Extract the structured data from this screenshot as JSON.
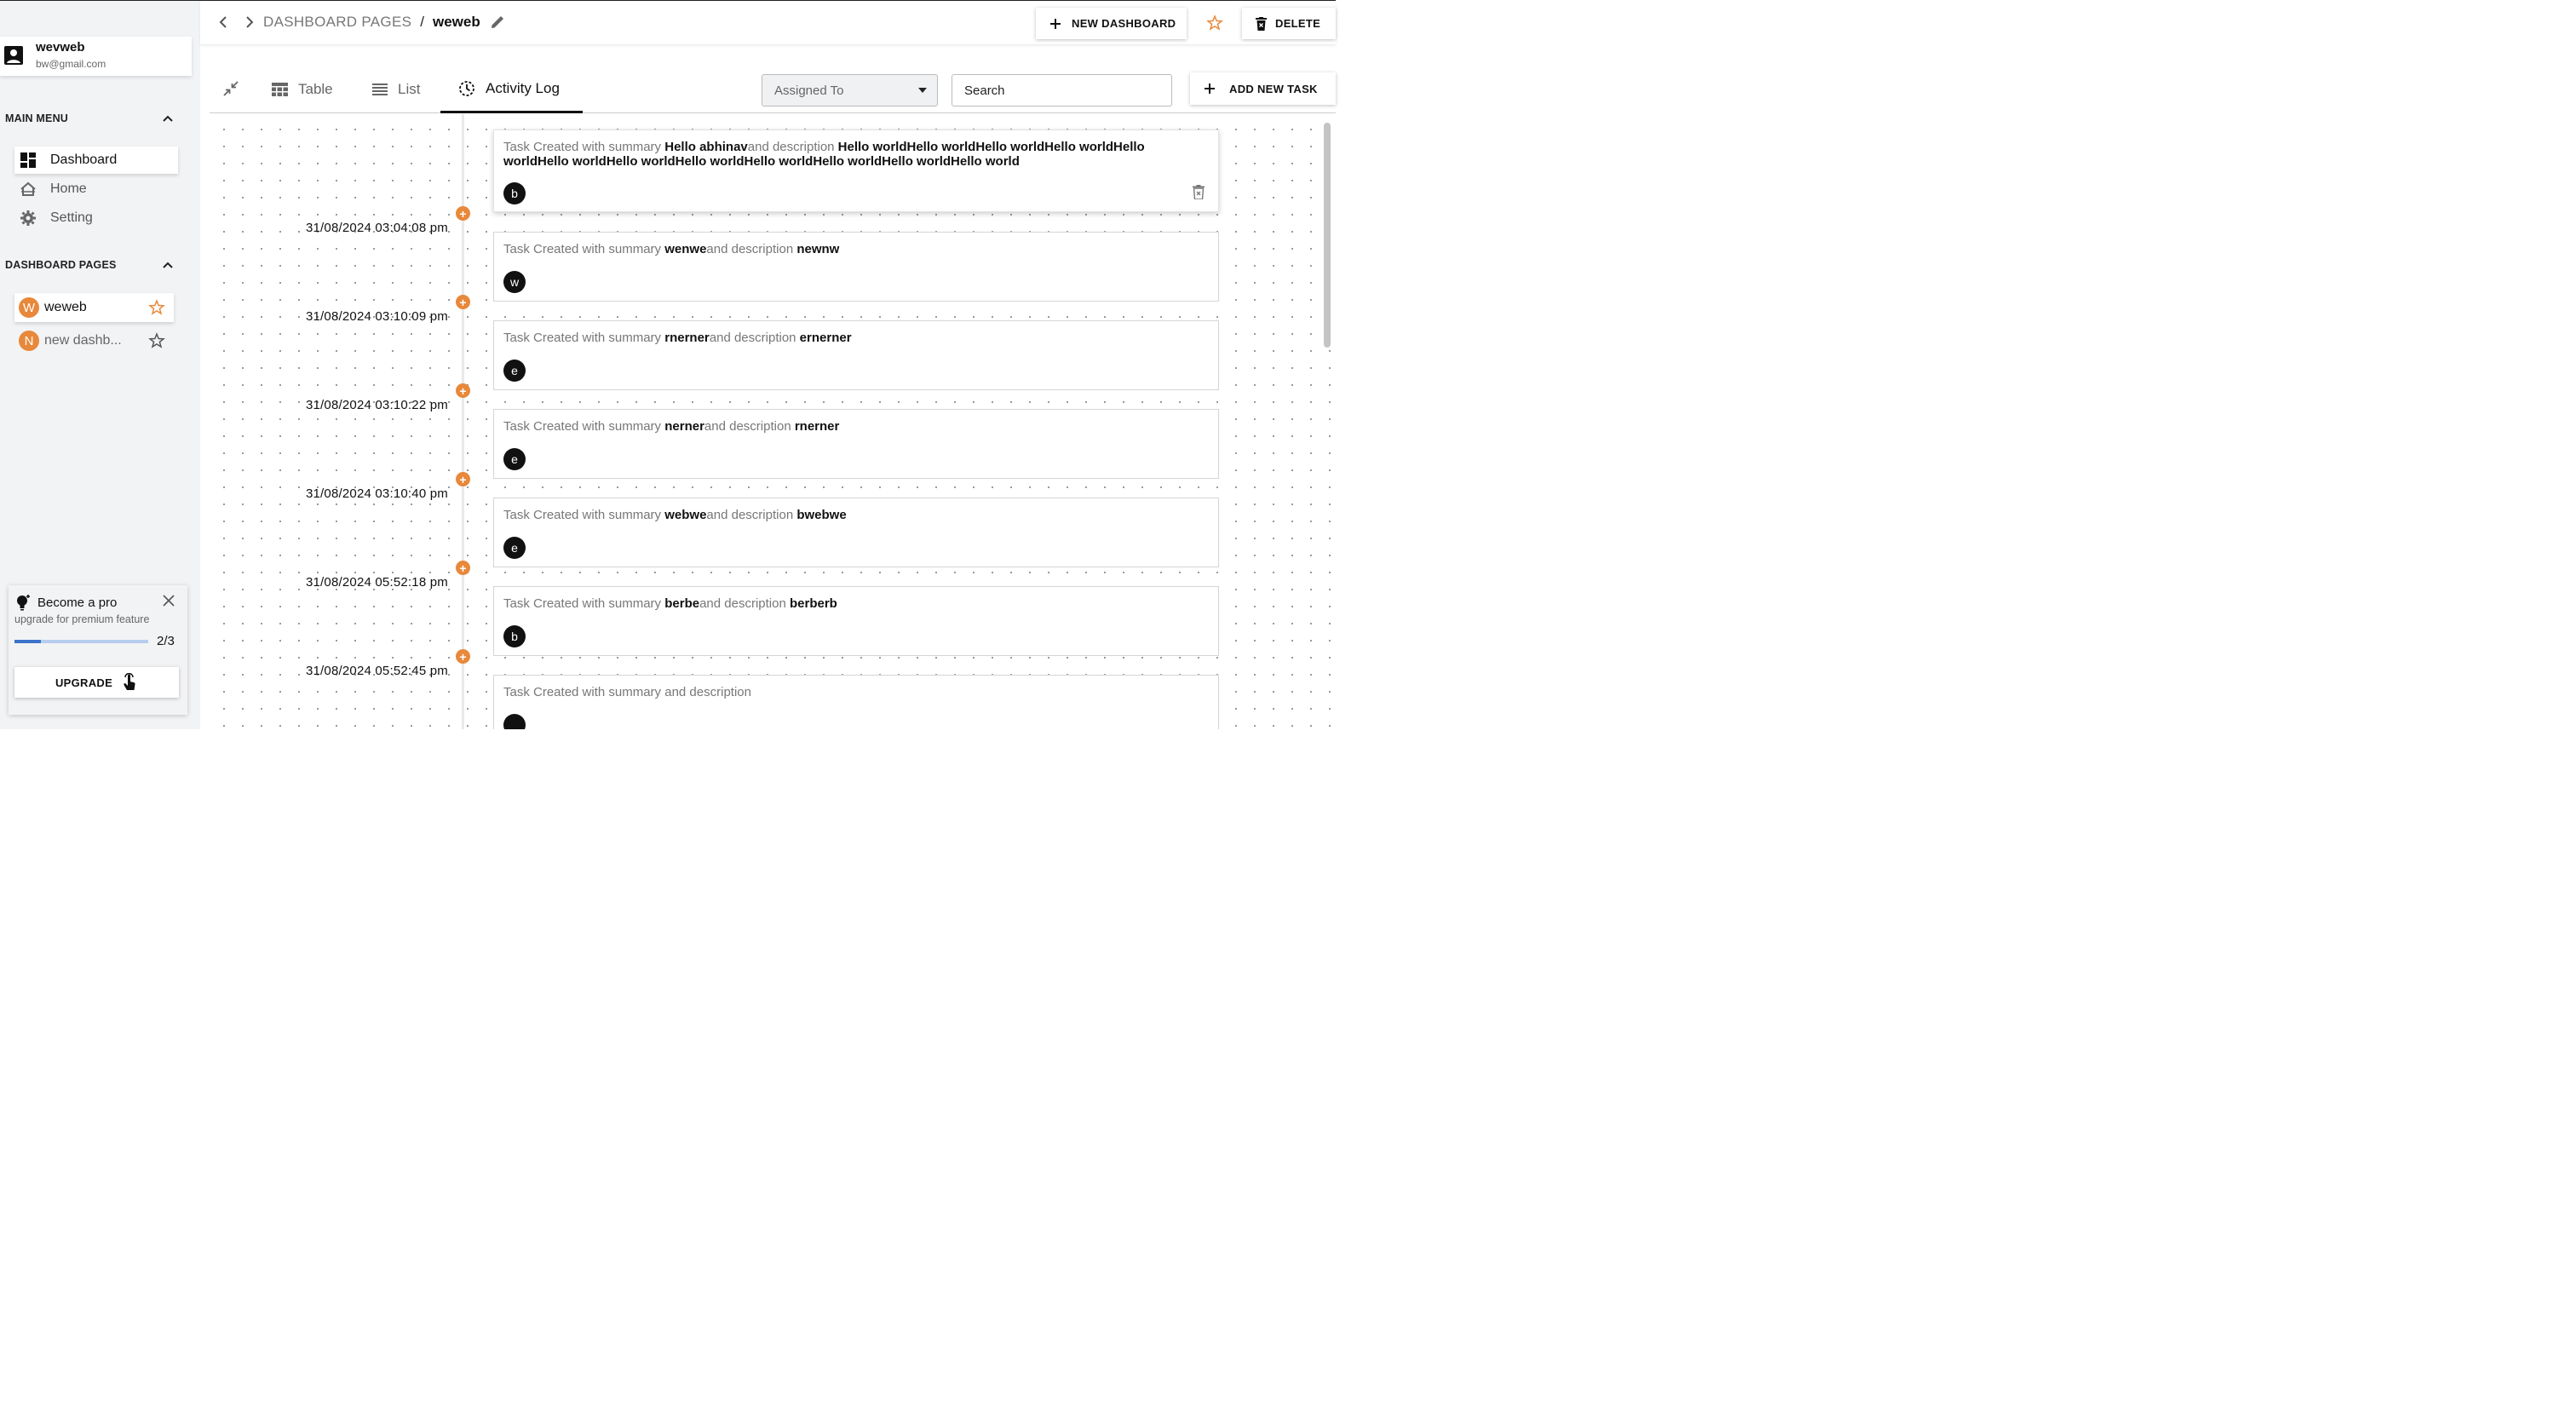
{
  "user": {
    "name": "wevweb",
    "email": "bw@gmail.com"
  },
  "sidebar": {
    "main_menu_title": "MAIN MENU",
    "menu": [
      {
        "label": "Dashboard",
        "icon": "dashboard-icon",
        "active": true
      },
      {
        "label": "Home",
        "icon": "home-icon",
        "active": false
      },
      {
        "label": "Setting",
        "icon": "gear-icon",
        "active": false
      }
    ],
    "pages_title": "DASHBOARD PAGES",
    "pages": [
      {
        "initial": "W",
        "label": "weweb",
        "active": true,
        "favorite": true
      },
      {
        "initial": "N",
        "label": "new dashb...",
        "active": false,
        "favorite": false
      }
    ]
  },
  "promo": {
    "title": "Become a pro",
    "subtitle": "upgrade for premium feature",
    "progress_fraction": 0.2,
    "count": "2/3",
    "button": "UPGRADE"
  },
  "header": {
    "breadcrumb_root": "DASHBOARD PAGES",
    "breadcrumb_sep": "/",
    "breadcrumb_current": "weweb",
    "new_dashboard": "NEW DASHBOARD",
    "delete": "DELETE"
  },
  "toolbar": {
    "tabs": [
      {
        "label": "Table",
        "icon": "table-icon"
      },
      {
        "label": "List",
        "icon": "list-icon"
      },
      {
        "label": "Activity Log",
        "icon": "history-icon",
        "active": true
      }
    ],
    "assigned_placeholder": "Assigned To",
    "search_placeholder": "Search",
    "add_task": "ADD NEW TASK"
  },
  "activity": {
    "prefix": "Task Created with summary ",
    "middle": "and description ",
    "entries": [
      {
        "time": "",
        "summary": "Hello abhinav",
        "description": "Hello worldHello worldHello worldHello worldHello worldHello worldHello worldHello worldHello worldHello worldHello worldHello world",
        "avatar": "b"
      },
      {
        "time": "31/08/2024 03:04:08 pm",
        "summary": "wenwe",
        "description": "newnw",
        "avatar": "w"
      },
      {
        "time": "31/08/2024 03:10:09 pm",
        "summary": "rnerner",
        "description": "ernerner",
        "avatar": "e"
      },
      {
        "time": "31/08/2024 03:10:22 pm",
        "summary": "nerner",
        "description": "rnerner",
        "avatar": "e"
      },
      {
        "time": "31/08/2024 03:10:40 pm",
        "summary": "webwe",
        "description": "bwebwe",
        "avatar": "e"
      },
      {
        "time": "31/08/2024 05:52:18 pm",
        "summary": "berbe",
        "description": "berberb",
        "avatar": "b"
      },
      {
        "time": "31/08/2024 05:52:45 pm",
        "summary": "",
        "description": "",
        "avatar": ""
      }
    ]
  },
  "colors": {
    "accent": "#e8883a",
    "progress": "#3b73c9",
    "sidebar_bg": "#f2f3f5"
  }
}
